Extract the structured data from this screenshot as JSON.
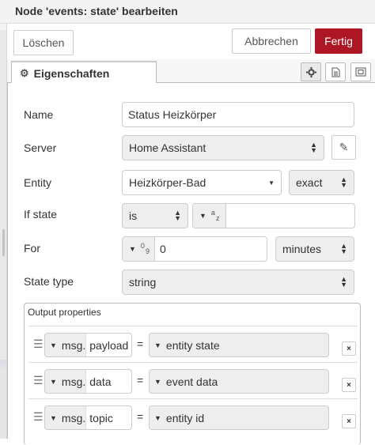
{
  "dialog": {
    "title": "Node 'events: state' bearbeiten"
  },
  "toolbar": {
    "delete_label": "Löschen",
    "cancel_label": "Abbrechen",
    "done_label": "Fertig"
  },
  "tabs": {
    "properties_label": "Eigenschaften"
  },
  "form": {
    "name": {
      "label": "Name",
      "value": "Status Heizkörper"
    },
    "server": {
      "label": "Server",
      "value": "Home Assistant"
    },
    "entity": {
      "label": "Entity",
      "value": "Heizkörper-Bad",
      "match": "exact"
    },
    "if_state": {
      "label": "If state",
      "operator": "is",
      "type_sup": "a",
      "type_sub": "z",
      "value": ""
    },
    "for": {
      "label": "For",
      "type_sup": "0",
      "type_sub": "9",
      "value": "0",
      "unit": "minutes"
    },
    "state_type": {
      "label": "State type",
      "value": "string"
    }
  },
  "output": {
    "title": "Output properties",
    "rows": [
      {
        "prefix": "msg.",
        "property": "payload",
        "eq": "=",
        "value": "entity state",
        "delete": "×"
      },
      {
        "prefix": "msg.",
        "property": "data",
        "eq": "=",
        "value": "event data",
        "delete": "×"
      },
      {
        "prefix": "msg.",
        "property": "topic",
        "eq": "=",
        "value": "entity id",
        "delete": "×"
      }
    ]
  },
  "colors": {
    "accent": "#ad1625"
  }
}
